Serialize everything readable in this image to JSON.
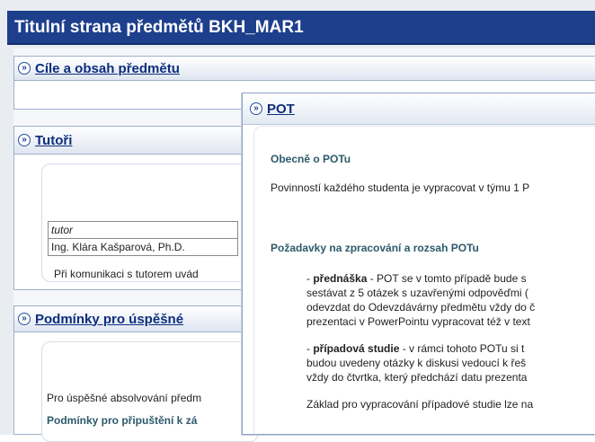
{
  "page": {
    "title": "Titulní strana předmětů BKH_MAR1"
  },
  "sections": {
    "cile": {
      "title": "Cíle a obsah předmětu"
    },
    "tutori": {
      "title": "Tutoři",
      "table_header": "tutor",
      "table_row": "Ing. Klára Kašparová, Ph.D.",
      "note": "Při komunikaci s tutorem uvád"
    },
    "podminky": {
      "title": "Podmínky pro úspěšné",
      "text": "Pro úspěšné absolvování předm",
      "subheading": "Podmínky pro připuštění k zá"
    }
  },
  "pot_dialog": {
    "title": "POT",
    "heading1": "Obecně o POTu",
    "line1": "Povinností každého studenta je vypracovat v týmu 1 P",
    "heading2": "Požadavky na zpracování a rozsah POTu",
    "p1_term": "přednáška",
    "p1_line1_prefix": "- ",
    "p1_line1_rest": " - POT se v tomto případě bude s",
    "p1_line2": "sestávat z 5 otázek s uzavřenými odpověďmi (",
    "p1_line3": "odevzdat do Odevzdávárny předmětu vždy do č",
    "p1_line4": "prezentaci v PowerPointu vypracovat též v text",
    "p2_term": "případová studie",
    "p2_line1_prefix": "- ",
    "p2_line1_rest": " - v rámci tohoto POTu si t",
    "p2_line2": "budou uvedeny otázky k diskusi vedoucí k řeš",
    "p2_line3": "vždy do čtvrtka, který předchází datu prezenta",
    "p3_line1": "Základ pro vypracování případové studie lze na"
  }
}
